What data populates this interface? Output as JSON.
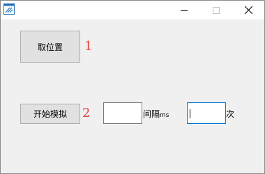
{
  "titlebar": {
    "app_icon": "app-window-icon",
    "minimize_icon": "minimize-icon",
    "maximize_icon": "maximize-icon",
    "close_icon": "close-icon"
  },
  "controls": {
    "get_position_label": "取位置",
    "start_simulation_label": "开始模拟",
    "interval_label": "间隔",
    "interval_unit": "ms",
    "count_label": "次"
  },
  "markers": {
    "first": "1",
    "second": "2"
  },
  "inputs": {
    "interval_value": "",
    "count_value": ""
  },
  "colors": {
    "marker": "#e8403a",
    "focused_border": "#0078d7",
    "button_face": "#e1e1e1",
    "window_bg": "#f0f0f0"
  }
}
